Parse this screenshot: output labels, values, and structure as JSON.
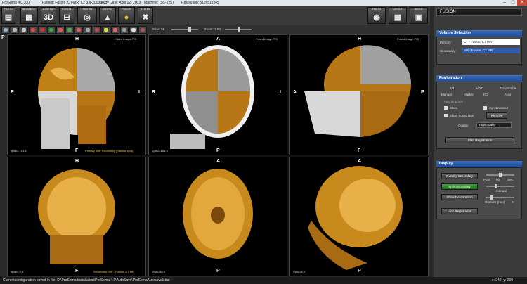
{
  "titlebar": {
    "app": "ProSoma 4.0.300",
    "patient": "Patient: Fusion, CT-MR, ID: 33F200306",
    "study_date": "Study Date: April 22, 2003",
    "machine": "Machine: ISC-2257",
    "resolution": "Resolution: 512x512x45"
  },
  "toolbar": {
    "buttons": [
      {
        "label": "FILE ID",
        "icon": "document-icon"
      },
      {
        "label": "BEAM EDIT",
        "icon": "mode-3d-icon"
      },
      {
        "label": "3D SETUP",
        "icon": "3d-text-icon"
      },
      {
        "label": "PORTAL",
        "icon": "portal-icon"
      },
      {
        "label": "HISTORY",
        "icon": "history-icon"
      },
      {
        "label": "OUTPUT",
        "icon": "output-icon"
      },
      {
        "label": "FUSION",
        "icon": "fusion-icon"
      },
      {
        "label": "SYSTEM",
        "icon": "tools-icon"
      }
    ],
    "right_buttons": [
      "PHOTO",
      "LAYOUT",
      "ABOUT"
    ],
    "text_3d": "3D"
  },
  "toolbar2": {
    "slice_label": "Slice: 55",
    "zoom_label": "Zoom: 1.00"
  },
  "viewer": {
    "corner_label": "P",
    "panes": [
      {
        "top": "H",
        "bottom": "F",
        "left": "R",
        "right": "L",
        "title": "Fused Image P/S",
        "zpos": "Ypos=-101.3",
        "caption": "Primary over Secondary (manual split)"
      },
      {
        "top": "A",
        "bottom": "P",
        "left": "R",
        "right": "L",
        "title": "Fused Image P/S",
        "zpos": "Zpos=-101.3",
        "caption": ""
      },
      {
        "top": "H",
        "bottom": "F",
        "left": "A",
        "right": "P",
        "title": "Fused Image P/S",
        "zpos": "",
        "caption": ""
      },
      {
        "top": "H",
        "bottom": "F",
        "left": "",
        "right": "",
        "title": "",
        "zpos": "Ypos=-9.4",
        "caption": "Secondary: MR - Fusion, CT MR"
      },
      {
        "top": "A",
        "bottom": "P",
        "left": "",
        "right": "",
        "title": "",
        "zpos": "Zpos=36.6",
        "caption": ""
      },
      {
        "top": "A",
        "bottom": "P",
        "left": "",
        "right": "",
        "title": "",
        "zpos": "Xpos=4.6",
        "caption": ""
      }
    ]
  },
  "right_panel": {
    "title": "FUSION",
    "volume": {
      "header": "Volume Selection",
      "primary_label": "Primary:",
      "primary_value": "CT - Fusion, CT MR",
      "secondary_label": "Secondary:",
      "secondary_value": "MR - Fusion, CT MR"
    },
    "registration": {
      "header": "Registration",
      "mode_labels": [
        "6/3",
        "6/DT",
        "Deformable"
      ],
      "method_labels": [
        "Manual",
        "Marker",
        "ICI",
        "Auto"
      ],
      "section_label": "Matching box",
      "show_label": "Show",
      "synchronized_label": "Synchronized",
      "show_fused_label": "Show Fused Box",
      "remove_label": "Remove",
      "quality_label": "Quality:",
      "quality_value": "High quality",
      "start_label": "Start Registration"
    },
    "display": {
      "header": "Display",
      "overlay_label": "Overlay Secondary",
      "split_label": "Split Secondary",
      "show_def_label": "Show Deformation",
      "lock_label": "Lock Registration",
      "prim_label": "Prim.",
      "pct_label": "50",
      "sec_label": "Sec.",
      "manual_label": "manual",
      "gridsize_label": "Gridsize (mm)",
      "gridsize_value": "5"
    }
  },
  "status": {
    "text": "Current configuration saved in file: D:\\ProSoma Installation\\ProSoma 4.0\\AutoSave\\ProSomaAutosave1.bat",
    "coords": "x: 242, y: 290"
  },
  "colors": {
    "accent": "#2d5fae",
    "split_button": "#2f8a2f",
    "mr_tone": "#d9a020",
    "ct_tone": "#bdbdbd"
  }
}
